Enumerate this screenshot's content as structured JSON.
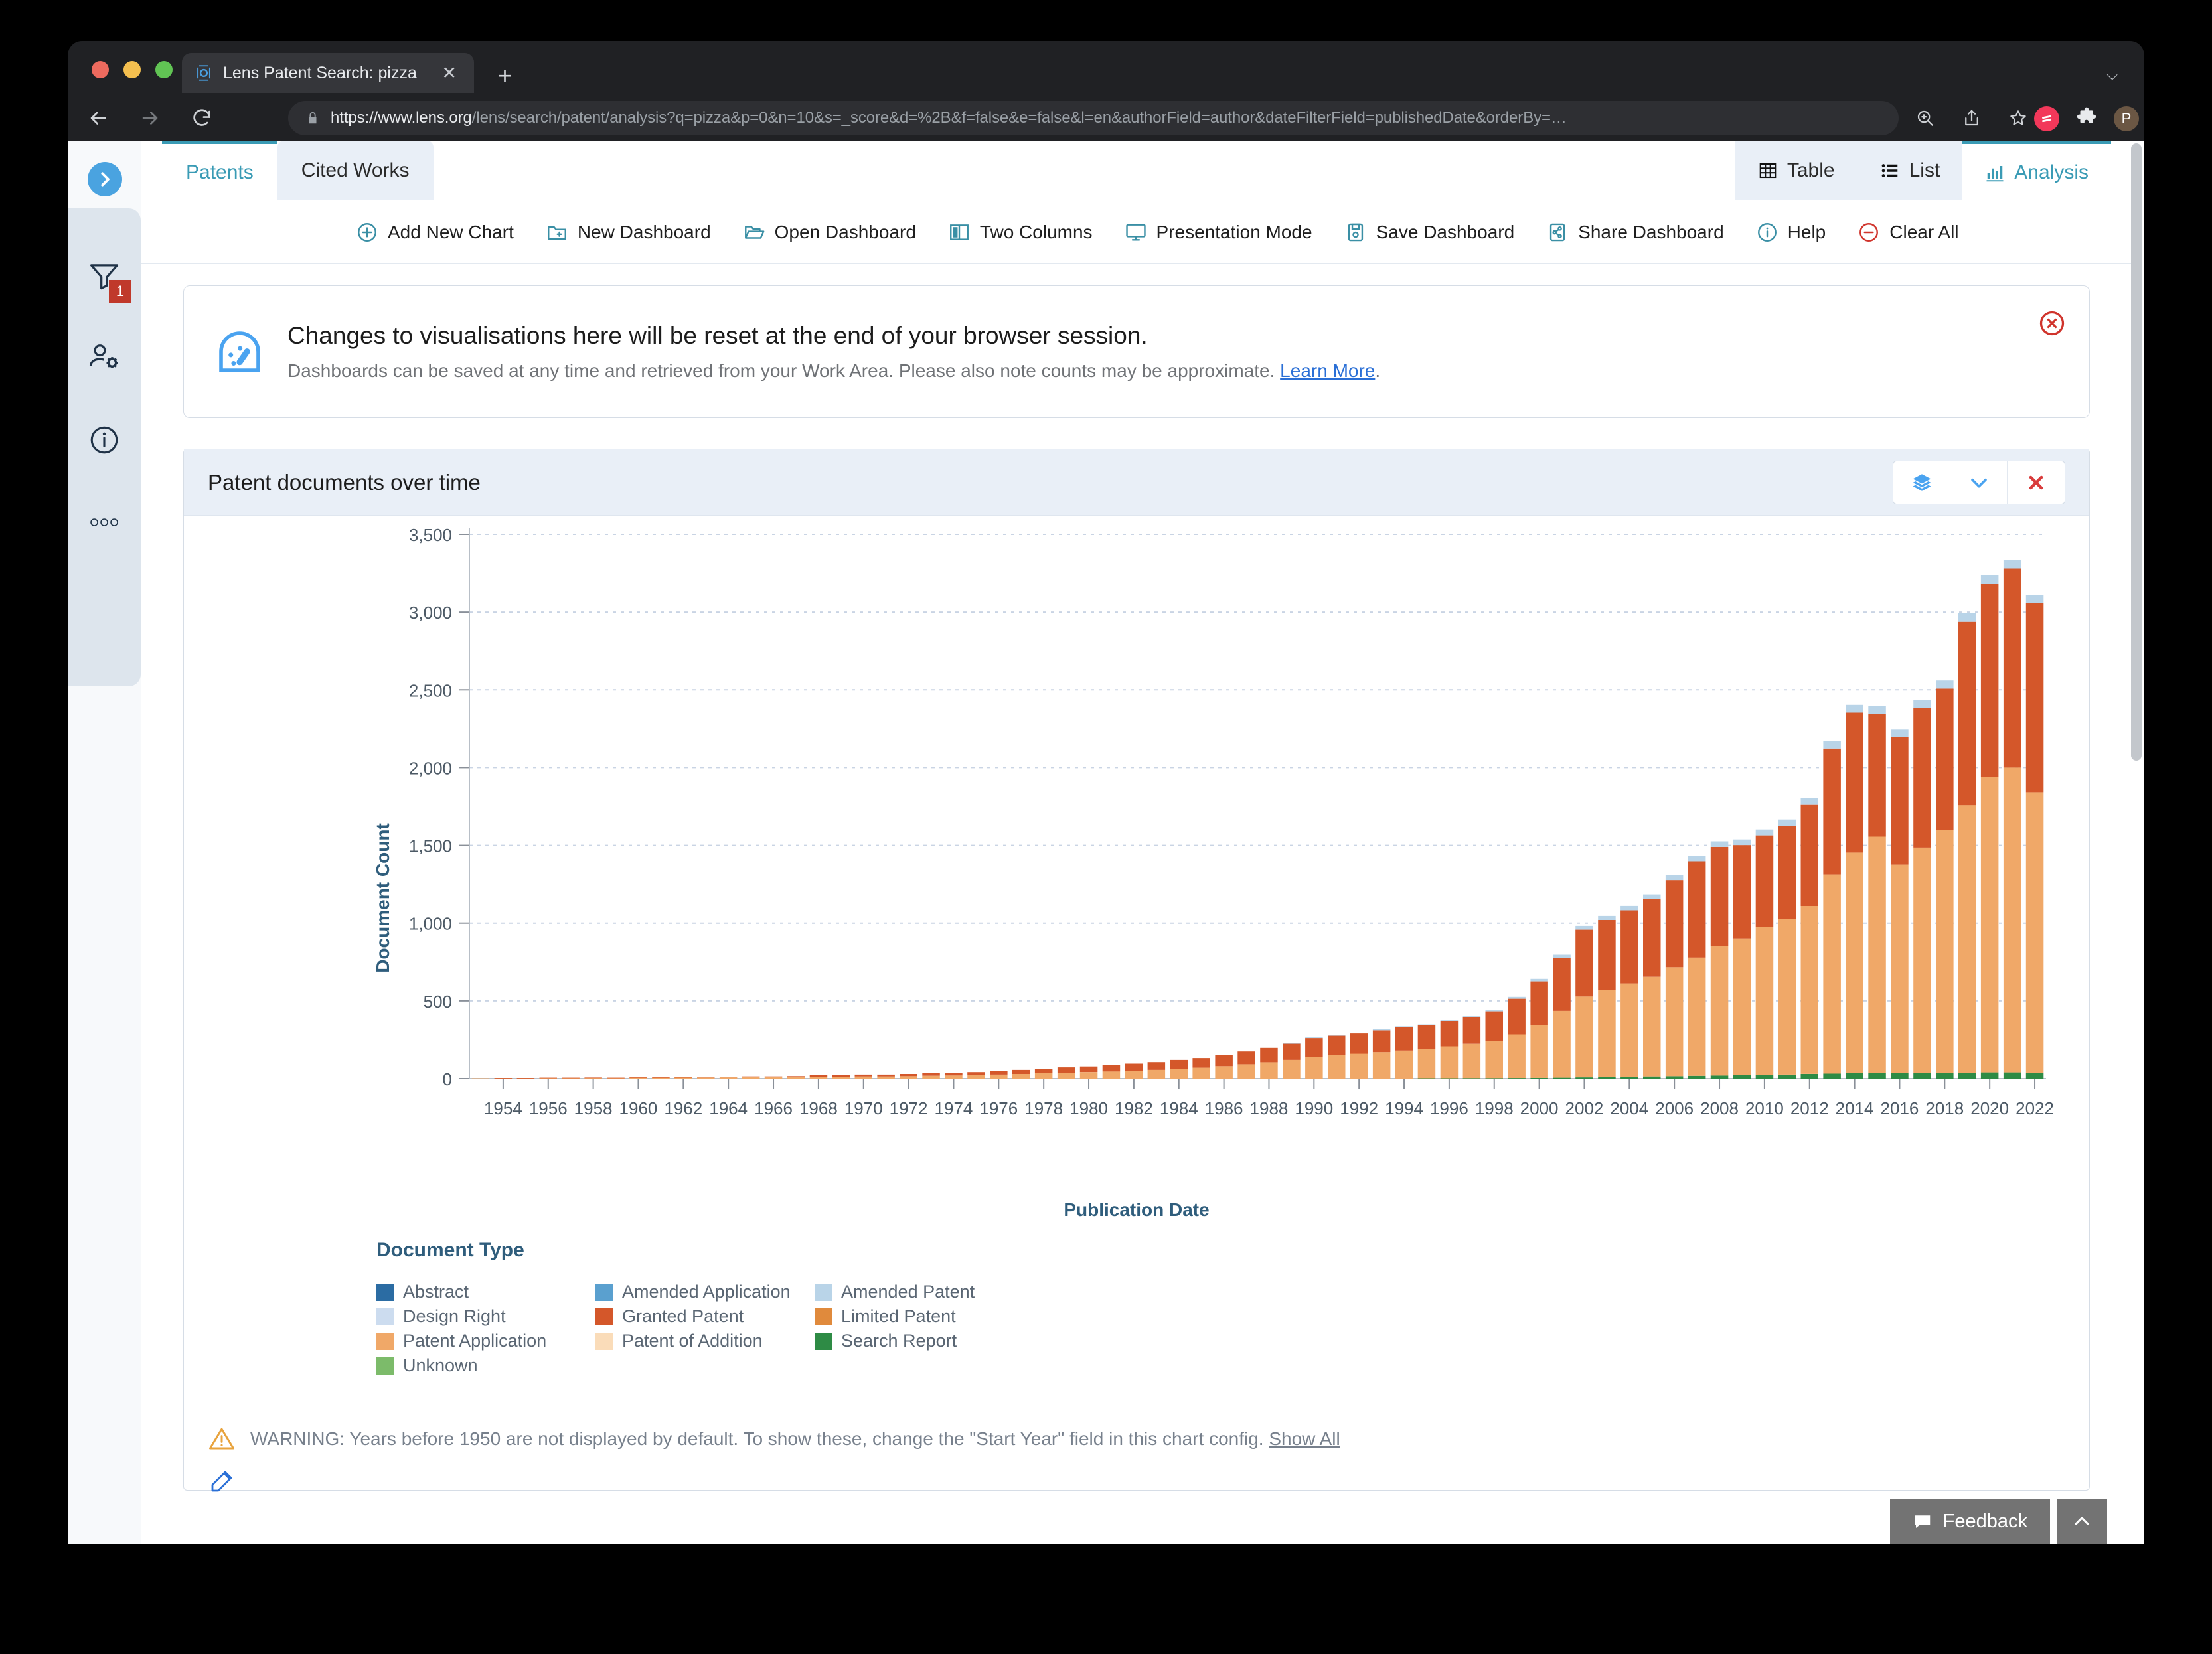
{
  "browser": {
    "tab_title": "Lens Patent Search: pizza",
    "tab_favicon": "lens-logo-icon",
    "new_tab_label": "+",
    "url_bold": "https://www.lens.org",
    "url_rest": "/lens/search/patent/analysis?q=pizza&p=0&n=10&s=_score&d=%2B&f=false&e=false&l=en&authorField=author&dateFilterField=publishedDate&orderBy=…",
    "profile_initial": "P"
  },
  "sidebar": {
    "items": [
      {
        "name": "expand-toggle",
        "icon": "chevron-right-icon"
      },
      {
        "name": "filter",
        "icon": "funnel-icon",
        "badge": "1"
      },
      {
        "name": "user-settings",
        "icon": "user-gear-icon"
      },
      {
        "name": "info",
        "icon": "info-circle-icon"
      },
      {
        "name": "more",
        "icon": "ellipsis-icon"
      }
    ]
  },
  "tabs": {
    "primary": [
      {
        "label": "Patents",
        "active": true
      },
      {
        "label": "Cited Works",
        "active": false
      }
    ],
    "views": [
      {
        "label": "Table",
        "icon": "table-icon",
        "active": false
      },
      {
        "label": "List",
        "icon": "list-icon",
        "active": false
      },
      {
        "label": "Analysis",
        "icon": "bar-chart-icon",
        "active": true
      }
    ]
  },
  "toolbar": {
    "items": [
      {
        "label": "Add New Chart",
        "icon": "plus-circle-icon"
      },
      {
        "label": "New Dashboard",
        "icon": "folder-plus-icon"
      },
      {
        "label": "Open Dashboard",
        "icon": "folder-open-icon"
      },
      {
        "label": "Two Columns",
        "icon": "columns-icon"
      },
      {
        "label": "Presentation Mode",
        "icon": "monitor-icon"
      },
      {
        "label": "Save Dashboard",
        "icon": "save-icon"
      },
      {
        "label": "Share Dashboard",
        "icon": "share-icon"
      },
      {
        "label": "Help",
        "icon": "info-circle-icon"
      },
      {
        "label": "Clear All",
        "icon": "minus-circle-icon"
      }
    ]
  },
  "banner": {
    "icon": "dashboard-gauge-icon",
    "heading": "Changes to visualisations here will be reset at the end of your browser session.",
    "body": "Dashboards can be saved at any time and retrieved from your Work Area. Please also note counts may be approximate.",
    "link": "Learn More",
    "close_icon": "close-circle-icon"
  },
  "chart_card": {
    "title": "Patent documents over time",
    "buttons": [
      {
        "name": "layers-button",
        "icon": "layers-icon"
      },
      {
        "name": "collapse-button",
        "icon": "chevron-down-icon"
      },
      {
        "name": "remove-button",
        "icon": "close-x-icon"
      }
    ],
    "warning": {
      "icon": "warning-triangle-icon",
      "text": "WARNING: Years before 1950 are not displayed by default. To show these, change the \"Start Year\" field in this chart config.",
      "link": "Show All"
    },
    "edit_icon": "edit-pencil-icon"
  },
  "footer": {
    "feedback_label": "Feedback",
    "feedback_icon": "speech-bubble-icon",
    "scroll_top_icon": "chevron-up-icon"
  },
  "chart_data": {
    "type": "bar",
    "stacked": true,
    "title": "Patent documents over time",
    "xlabel": "Publication Date",
    "ylabel": "Document Count",
    "ylim": [
      0,
      3500
    ],
    "yticks": [
      0,
      500,
      1000,
      1500,
      2000,
      2500,
      3000,
      3500
    ],
    "ytick_labels": [
      "0",
      "500",
      "1,000",
      "1,500",
      "2,000",
      "2,500",
      "3,000",
      "3,500"
    ],
    "grid": true,
    "legend_title": "Document Type",
    "legend_position": "below",
    "xtick_labels": [
      "1954",
      "1956",
      "1958",
      "1960",
      "1962",
      "1964",
      "1966",
      "1968",
      "1970",
      "1972",
      "1974",
      "1976",
      "1978",
      "1980",
      "1982",
      "1984",
      "1986",
      "1988",
      "1990",
      "1992",
      "1994",
      "1996",
      "1998",
      "2000",
      "2002",
      "2004",
      "2006",
      "2008",
      "2010",
      "2012",
      "2014",
      "2016",
      "2018",
      "2020",
      "2022"
    ],
    "categories": [
      "1953",
      "1954",
      "1955",
      "1956",
      "1957",
      "1958",
      "1959",
      "1960",
      "1961",
      "1962",
      "1963",
      "1964",
      "1965",
      "1966",
      "1967",
      "1968",
      "1969",
      "1970",
      "1971",
      "1972",
      "1973",
      "1974",
      "1975",
      "1976",
      "1977",
      "1978",
      "1979",
      "1980",
      "1981",
      "1982",
      "1983",
      "1984",
      "1985",
      "1986",
      "1987",
      "1988",
      "1989",
      "1990",
      "1991",
      "1992",
      "1993",
      "1994",
      "1995",
      "1996",
      "1997",
      "1998",
      "1999",
      "2000",
      "2001",
      "2002",
      "2003",
      "2004",
      "2005",
      "2006",
      "2007",
      "2008",
      "2009",
      "2010",
      "2011",
      "2012",
      "2013",
      "2014",
      "2015",
      "2016",
      "2017",
      "2018",
      "2019",
      "2020",
      "2021",
      "2022"
    ],
    "series": [
      {
        "name": "Unknown",
        "color": "#7cbb6a",
        "values": [
          0,
          0,
          0,
          0,
          0,
          0,
          0,
          0,
          0,
          0,
          0,
          0,
          0,
          0,
          0,
          0,
          0,
          0,
          0,
          0,
          0,
          0,
          0,
          0,
          0,
          0,
          0,
          0,
          0,
          0,
          0,
          0,
          0,
          0,
          0,
          0,
          0,
          0,
          0,
          0,
          0,
          0,
          0,
          0,
          0,
          0,
          0,
          0,
          0,
          0,
          0,
          0,
          0,
          0,
          0,
          0,
          0,
          0,
          0,
          0,
          0,
          0,
          0,
          0,
          0,
          0,
          0,
          0,
          0,
          0
        ]
      },
      {
        "name": "Search Report",
        "color": "#2e8b45",
        "values": [
          0,
          0,
          0,
          0,
          0,
          0,
          0,
          0,
          0,
          0,
          0,
          0,
          0,
          0,
          0,
          0,
          0,
          0,
          0,
          0,
          0,
          0,
          0,
          0,
          0,
          0,
          0,
          0,
          0,
          0,
          0,
          0,
          0,
          0,
          0,
          0,
          0,
          0,
          0,
          0,
          0,
          0,
          2,
          2,
          3,
          3,
          4,
          5,
          6,
          8,
          10,
          12,
          14,
          16,
          18,
          20,
          22,
          24,
          26,
          30,
          32,
          34,
          36,
          36,
          36,
          38,
          38,
          40,
          40,
          38
        ]
      },
      {
        "name": "Patent Application",
        "color": "#f0a868",
        "values": [
          2,
          3,
          3,
          4,
          4,
          5,
          4,
          6,
          6,
          7,
          7,
          8,
          9,
          9,
          10,
          12,
          12,
          14,
          14,
          16,
          18,
          20,
          22,
          26,
          30,
          34,
          38,
          42,
          46,
          50,
          56,
          64,
          70,
          80,
          92,
          105,
          120,
          140,
          150,
          160,
          170,
          180,
          190,
          205,
          220,
          240,
          280,
          340,
          430,
          520,
          560,
          600,
          640,
          700,
          760,
          830,
          880,
          950,
          1000,
          1080,
          1280,
          1420,
          1520,
          1340,
          1450,
          1560,
          1720,
          1900,
          1960,
          1800
        ]
      },
      {
        "name": "Patent of Addition",
        "color": "#fadcb9",
        "values": [
          0,
          0,
          0,
          0,
          0,
          0,
          0,
          0,
          0,
          0,
          0,
          0,
          0,
          0,
          0,
          0,
          0,
          0,
          0,
          0,
          0,
          0,
          0,
          0,
          0,
          0,
          0,
          0,
          0,
          0,
          0,
          0,
          0,
          0,
          0,
          0,
          0,
          0,
          0,
          0,
          0,
          0,
          0,
          0,
          0,
          0,
          0,
          0,
          0,
          0,
          0,
          0,
          0,
          0,
          0,
          0,
          0,
          0,
          0,
          0,
          0,
          0,
          0,
          0,
          0,
          0,
          0,
          0,
          0,
          0
        ]
      },
      {
        "name": "Granted Patent",
        "color": "#d4572a",
        "values": [
          0,
          1,
          1,
          2,
          2,
          2,
          2,
          3,
          3,
          3,
          4,
          4,
          5,
          5,
          6,
          10,
          10,
          12,
          12,
          14,
          16,
          18,
          20,
          24,
          26,
          30,
          34,
          36,
          40,
          46,
          50,
          56,
          62,
          72,
          82,
          92,
          105,
          120,
          125,
          130,
          140,
          150,
          150,
          160,
          170,
          190,
          230,
          280,
          340,
          430,
          450,
          470,
          500,
          560,
          620,
          640,
          600,
          590,
          600,
          650,
          810,
          900,
          790,
          820,
          900,
          910,
          1180,
          1240,
          1280,
          1220
        ]
      },
      {
        "name": "Limited Patent",
        "color": "#e08a3c",
        "values": [
          0,
          0,
          0,
          0,
          0,
          0,
          0,
          0,
          0,
          0,
          0,
          0,
          0,
          0,
          0,
          0,
          0,
          0,
          0,
          0,
          0,
          0,
          0,
          0,
          0,
          0,
          0,
          0,
          0,
          0,
          0,
          0,
          0,
          0,
          0,
          0,
          0,
          0,
          0,
          0,
          0,
          0,
          0,
          0,
          0,
          0,
          0,
          0,
          0,
          0,
          0,
          0,
          0,
          0,
          0,
          0,
          0,
          0,
          0,
          0,
          0,
          0,
          0,
          0,
          0,
          0,
          0,
          0,
          0,
          0
        ]
      },
      {
        "name": "Amended Patent",
        "color": "#b9d4e8",
        "values": [
          0,
          0,
          0,
          0,
          0,
          0,
          0,
          0,
          0,
          0,
          0,
          0,
          0,
          0,
          0,
          0,
          0,
          0,
          0,
          0,
          0,
          0,
          0,
          0,
          0,
          0,
          0,
          0,
          0,
          0,
          0,
          0,
          0,
          0,
          0,
          0,
          2,
          4,
          4,
          4,
          6,
          6,
          6,
          8,
          8,
          10,
          12,
          16,
          20,
          24,
          26,
          28,
          30,
          32,
          34,
          36,
          36,
          38,
          40,
          44,
          48,
          50,
          50,
          48,
          50,
          52,
          54,
          56,
          56,
          50
        ]
      },
      {
        "name": "Amended Application",
        "color": "#5aa0cf",
        "values": [
          0,
          0,
          0,
          0,
          0,
          0,
          0,
          0,
          0,
          0,
          0,
          0,
          0,
          0,
          0,
          0,
          0,
          0,
          0,
          0,
          0,
          0,
          0,
          0,
          0,
          0,
          0,
          0,
          0,
          0,
          0,
          0,
          0,
          0,
          0,
          0,
          0,
          0,
          0,
          0,
          0,
          0,
          0,
          0,
          0,
          0,
          0,
          0,
          0,
          0,
          0,
          0,
          0,
          0,
          0,
          0,
          0,
          0,
          0,
          0,
          0,
          0,
          0,
          0,
          0,
          0,
          0,
          0,
          0,
          0
        ]
      },
      {
        "name": "Abstract",
        "color": "#2b6ca3",
        "values": [
          0,
          0,
          0,
          0,
          0,
          0,
          0,
          0,
          0,
          0,
          0,
          0,
          0,
          0,
          0,
          0,
          0,
          0,
          0,
          0,
          0,
          0,
          0,
          0,
          0,
          0,
          0,
          0,
          0,
          0,
          0,
          0,
          0,
          0,
          0,
          0,
          0,
          0,
          0,
          0,
          0,
          0,
          0,
          0,
          0,
          0,
          0,
          0,
          0,
          0,
          0,
          0,
          0,
          0,
          0,
          0,
          0,
          0,
          0,
          0,
          0,
          0,
          0,
          0,
          0,
          0,
          0,
          0,
          0,
          0
        ]
      },
      {
        "name": "Design Right",
        "color": "#ccdcef",
        "values": [
          0,
          0,
          0,
          0,
          0,
          0,
          0,
          0,
          0,
          0,
          0,
          0,
          0,
          0,
          0,
          0,
          0,
          0,
          0,
          0,
          0,
          0,
          0,
          0,
          0,
          0,
          0,
          0,
          0,
          0,
          0,
          0,
          0,
          0,
          0,
          0,
          0,
          0,
          0,
          0,
          0,
          0,
          0,
          0,
          0,
          0,
          0,
          0,
          0,
          0,
          0,
          0,
          0,
          0,
          0,
          0,
          0,
          0,
          0,
          0,
          0,
          0,
          0,
          0,
          0,
          0,
          0,
          0,
          0,
          0
        ]
      }
    ],
    "legend_entries": [
      {
        "label": "Abstract",
        "color": "#2b6ca3"
      },
      {
        "label": "Amended Application",
        "color": "#5aa0cf"
      },
      {
        "label": "Amended Patent",
        "color": "#b9d4e8"
      },
      {
        "label": "Design Right",
        "color": "#ccdcef"
      },
      {
        "label": "Granted Patent",
        "color": "#d4572a"
      },
      {
        "label": "Limited Patent",
        "color": "#e08a3c"
      },
      {
        "label": "Patent Application",
        "color": "#f0a868"
      },
      {
        "label": "Patent of Addition",
        "color": "#fadcb9"
      },
      {
        "label": "Search Report",
        "color": "#2e8b45"
      },
      {
        "label": "Unknown",
        "color": "#7cbb6a"
      }
    ]
  }
}
